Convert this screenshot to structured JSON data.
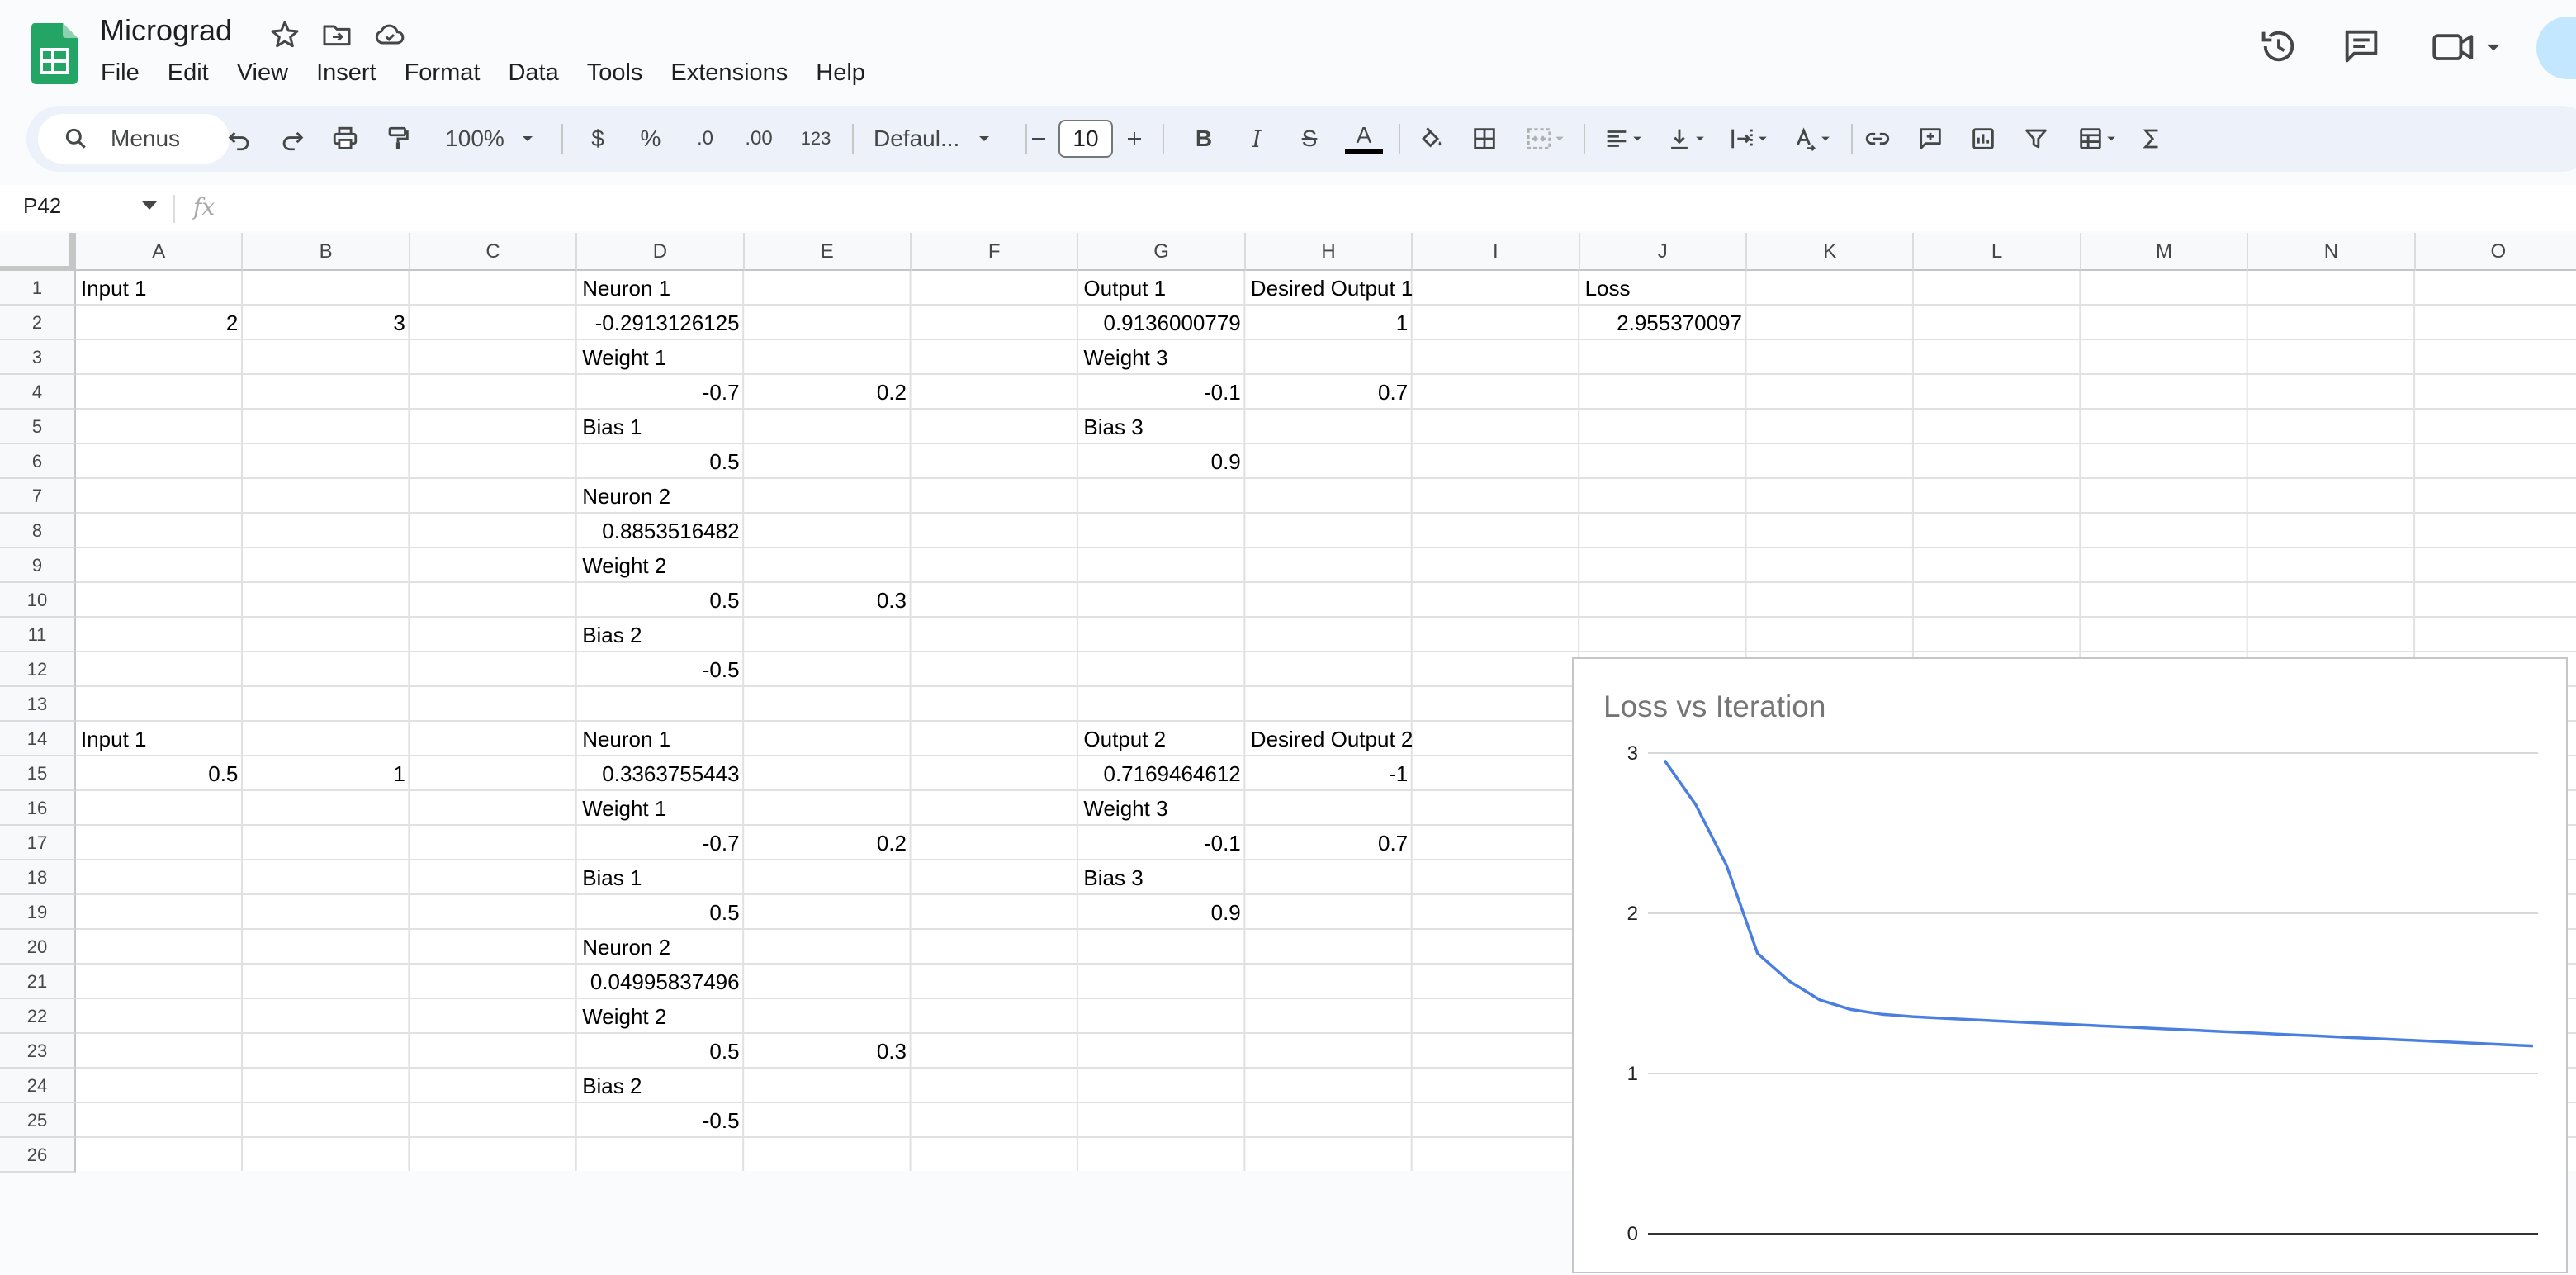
{
  "app": {
    "title": "Micrograd",
    "menus": [
      "File",
      "Edit",
      "View",
      "Insert",
      "Format",
      "Data",
      "Tools",
      "Extensions",
      "Help"
    ]
  },
  "toolbar": {
    "search_label": "Menus",
    "zoom": "100%",
    "currency": "$",
    "percent": "%",
    "dec_decrease": ".0",
    "dec_increase": ".00",
    "number_format": "123",
    "font": "Defaul...",
    "font_size": "10",
    "bold": "B",
    "italic": "I",
    "strikethrough": "S",
    "text_color": "A"
  },
  "formula_bar": {
    "name_box": "P42",
    "fx": "fx"
  },
  "grid": {
    "columns": [
      "A",
      "B",
      "C",
      "D",
      "E",
      "F",
      "G",
      "H",
      "I",
      "J",
      "K",
      "L",
      "M",
      "N",
      "O"
    ],
    "rows": [
      "1",
      "2",
      "3",
      "4",
      "5",
      "6",
      "7",
      "8",
      "9",
      "10",
      "11",
      "12",
      "13",
      "14",
      "15",
      "16",
      "17",
      "18",
      "19",
      "20",
      "21",
      "22",
      "23",
      "24",
      "25",
      "26"
    ],
    "cells": [
      {
        "ref": "A1",
        "value": "Input 1",
        "align": "left"
      },
      {
        "ref": "D1",
        "value": "Neuron 1",
        "align": "left"
      },
      {
        "ref": "G1",
        "value": "Output 1",
        "align": "left"
      },
      {
        "ref": "H1",
        "value": "Desired Output 1",
        "align": "left"
      },
      {
        "ref": "J1",
        "value": "Loss",
        "align": "left"
      },
      {
        "ref": "A2",
        "value": "2",
        "align": "right"
      },
      {
        "ref": "B2",
        "value": "3",
        "align": "right"
      },
      {
        "ref": "D2",
        "value": "-0.2913126125",
        "align": "right"
      },
      {
        "ref": "G2",
        "value": "0.9136000779",
        "align": "right"
      },
      {
        "ref": "H2",
        "value": "1",
        "align": "right"
      },
      {
        "ref": "J2",
        "value": "2.955370097",
        "align": "right"
      },
      {
        "ref": "D3",
        "value": "Weight 1",
        "align": "left"
      },
      {
        "ref": "G3",
        "value": "Weight 3",
        "align": "left"
      },
      {
        "ref": "D4",
        "value": "-0.7",
        "align": "right"
      },
      {
        "ref": "E4",
        "value": "0.2",
        "align": "right"
      },
      {
        "ref": "G4",
        "value": "-0.1",
        "align": "right"
      },
      {
        "ref": "H4",
        "value": "0.7",
        "align": "right"
      },
      {
        "ref": "D5",
        "value": "Bias 1",
        "align": "left"
      },
      {
        "ref": "G5",
        "value": "Bias 3",
        "align": "left"
      },
      {
        "ref": "D6",
        "value": "0.5",
        "align": "right"
      },
      {
        "ref": "G6",
        "value": "0.9",
        "align": "right"
      },
      {
        "ref": "D7",
        "value": "Neuron 2",
        "align": "left"
      },
      {
        "ref": "D8",
        "value": "0.8853516482",
        "align": "right"
      },
      {
        "ref": "D9",
        "value": "Weight 2",
        "align": "left"
      },
      {
        "ref": "D10",
        "value": "0.5",
        "align": "right"
      },
      {
        "ref": "E10",
        "value": "0.3",
        "align": "right"
      },
      {
        "ref": "D11",
        "value": "Bias 2",
        "align": "left"
      },
      {
        "ref": "D12",
        "value": "-0.5",
        "align": "right"
      },
      {
        "ref": "A14",
        "value": "Input 1",
        "align": "left"
      },
      {
        "ref": "D14",
        "value": "Neuron 1",
        "align": "left"
      },
      {
        "ref": "G14",
        "value": "Output 2",
        "align": "left"
      },
      {
        "ref": "H14",
        "value": "Desired Output 2",
        "align": "left"
      },
      {
        "ref": "A15",
        "value": "0.5",
        "align": "right"
      },
      {
        "ref": "B15",
        "value": "1",
        "align": "right"
      },
      {
        "ref": "D15",
        "value": "0.3363755443",
        "align": "right"
      },
      {
        "ref": "G15",
        "value": "0.7169464612",
        "align": "right"
      },
      {
        "ref": "H15",
        "value": "-1",
        "align": "right"
      },
      {
        "ref": "D16",
        "value": "Weight 1",
        "align": "left"
      },
      {
        "ref": "G16",
        "value": "Weight 3",
        "align": "left"
      },
      {
        "ref": "D17",
        "value": "-0.7",
        "align": "right"
      },
      {
        "ref": "E17",
        "value": "0.2",
        "align": "right"
      },
      {
        "ref": "G17",
        "value": "-0.1",
        "align": "right"
      },
      {
        "ref": "H17",
        "value": "0.7",
        "align": "right"
      },
      {
        "ref": "D18",
        "value": "Bias 1",
        "align": "left"
      },
      {
        "ref": "G18",
        "value": "Bias 3",
        "align": "left"
      },
      {
        "ref": "D19",
        "value": "0.5",
        "align": "right"
      },
      {
        "ref": "G19",
        "value": "0.9",
        "align": "right"
      },
      {
        "ref": "D20",
        "value": "Neuron 2",
        "align": "left"
      },
      {
        "ref": "D21",
        "value": "0.04995837496",
        "align": "right"
      },
      {
        "ref": "D22",
        "value": "Weight 2",
        "align": "left"
      },
      {
        "ref": "D23",
        "value": "0.5",
        "align": "right"
      },
      {
        "ref": "E23",
        "value": "0.3",
        "align": "right"
      },
      {
        "ref": "D24",
        "value": "Bias 2",
        "align": "left"
      },
      {
        "ref": "D25",
        "value": "-0.5",
        "align": "right"
      }
    ]
  },
  "chart_data": {
    "type": "line",
    "title": "Loss vs Iteration",
    "xlabel": "",
    "ylabel": "",
    "ylim": [
      0,
      3
    ],
    "yticks": [
      0,
      1,
      2,
      3
    ],
    "grid": true,
    "legend": "none",
    "series": [
      {
        "color": "#4a7fe0",
        "x": [
          0,
          1,
          2,
          3,
          4,
          5,
          6,
          7,
          8,
          9,
          10,
          11,
          12,
          13,
          14,
          15,
          16,
          17,
          18,
          19,
          20,
          21,
          22,
          23,
          24,
          25,
          26,
          27,
          28
        ],
        "values": [
          2.955,
          2.68,
          2.3,
          1.75,
          1.58,
          1.46,
          1.4,
          1.37,
          1.355,
          1.345,
          1.335,
          1.325,
          1.316,
          1.307,
          1.298,
          1.289,
          1.28,
          1.271,
          1.262,
          1.253,
          1.244,
          1.235,
          1.226,
          1.217,
          1.208,
          1.199,
          1.19,
          1.181,
          1.172
        ]
      }
    ]
  }
}
